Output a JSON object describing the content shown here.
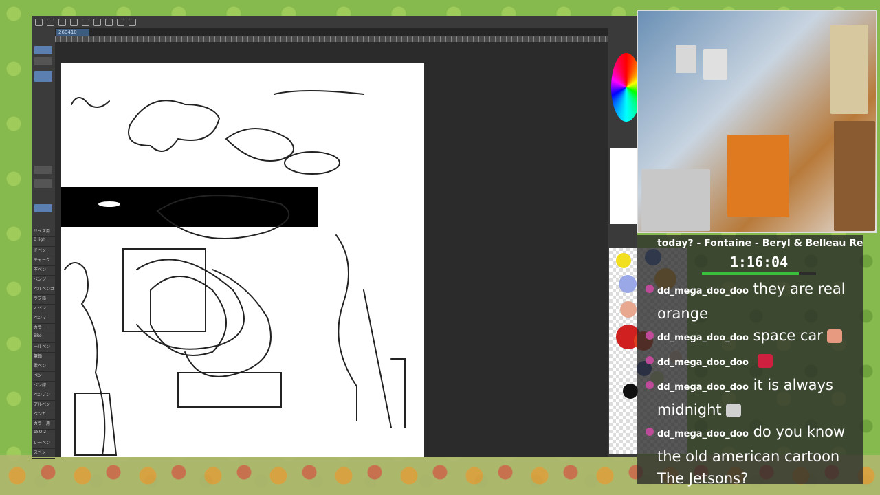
{
  "app": {
    "tab_label": "260410",
    "left_layer_labels": [
      "サイズ用",
      "B ligh",
      "ドペン",
      "チャーク",
      "不ペン",
      "ペンジ",
      "ペルペンガ",
      "ラフ鉛",
      "オペン",
      "ペンマ",
      "カラー",
      "BRo",
      "ールペン",
      "筆鉛",
      "柔ペン",
      "ペン",
      "ペン線",
      "ペンプン",
      "アルペン",
      "ペンガ",
      "カラー用",
      "1SO 2",
      "レーペン",
      "スペン"
    ],
    "palette_colors": [
      "#f2e020",
      "#4a78c8",
      "#9aa8e8",
      "#e8a890",
      "#d02020",
      "#e04020",
      "#f0b040",
      "#3a50a0",
      "#101010",
      "#e8d0c0",
      "#c8e0a0"
    ]
  },
  "stream": {
    "ticker_text": "today? - Fontaine - Beryl & Belleau Reg",
    "timer": "1:16:04",
    "timer_progress": 0.85,
    "chat": [
      {
        "user": "dd_mega_doo_doo",
        "text": "they are real orange",
        "emote": ""
      },
      {
        "user": "dd_mega_doo_doo",
        "text": "space car",
        "emote": "face-emote"
      },
      {
        "user": "dd_mega_doo_doo",
        "text": "",
        "emote": "red-emote"
      },
      {
        "user": "dd_mega_doo_doo",
        "text": "it is always midnight",
        "emote": "cat-emote"
      },
      {
        "user": "dd_mega_doo_doo",
        "text": "do you know the old american cartoon The Jetsons?",
        "emote": ""
      }
    ]
  },
  "colors": {
    "accent_blue": "#3d5c80",
    "timer_green": "#3ac03a",
    "chat_badge": "#c04a9a"
  }
}
